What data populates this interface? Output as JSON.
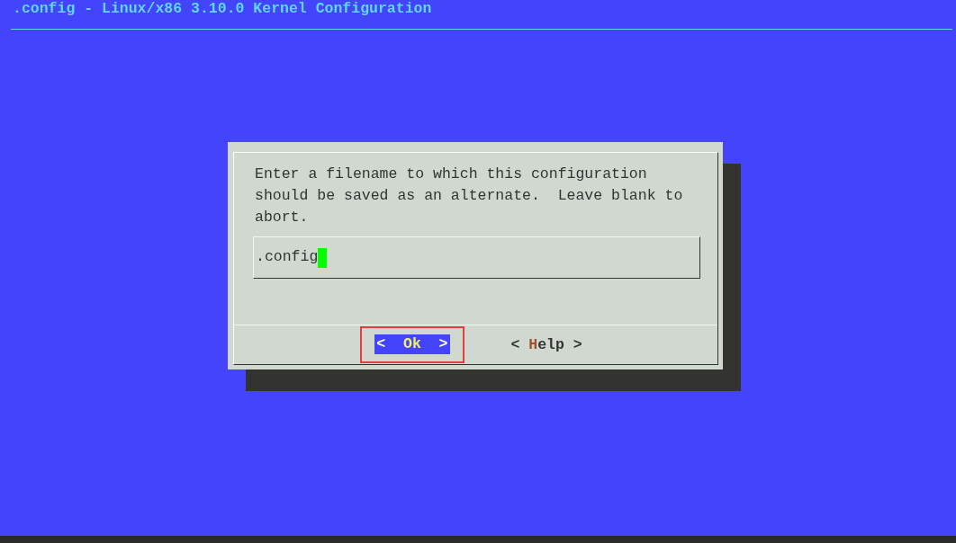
{
  "window": {
    "title": ".config - Linux/x86 3.10.0 Kernel Configuration"
  },
  "dialog": {
    "message": "Enter a filename to which this configuration should be saved as an alternate.  Leave blank to abort.",
    "field": {
      "value": ".config",
      "cursor": true
    },
    "buttons": [
      {
        "left": "<",
        "hotkey": "O",
        "rest": "k",
        "right": ">",
        "selected": true,
        "outlined": true
      },
      {
        "left": "<",
        "hotkey": "H",
        "rest": "elp",
        "right": ">",
        "selected": false,
        "outlined": false
      }
    ]
  }
}
